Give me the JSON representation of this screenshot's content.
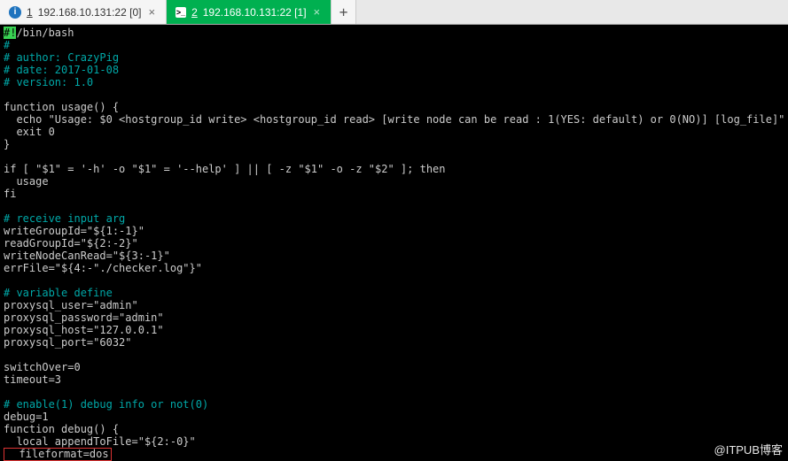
{
  "tabs": {
    "t0": {
      "num": "1",
      "label": "192.168.10.131:22 [0]"
    },
    "t1": {
      "num": "2",
      "label": "192.168.10.131:22 [1]"
    }
  },
  "newTabGlyph": "+",
  "closeGlyph": "×",
  "term": {
    "shebang": "#!",
    "sheb_rest": "/bin/bash",
    "c1": "#",
    "c2": "# author: CrazyPig",
    "c3": "# date: 2017-01-08",
    "c4": "# version: 1.0",
    "l_funcusage": "function usage() {",
    "l_echo": "  echo \"Usage: $0 <hostgroup_id write> <hostgroup_id read> [write node can be read : 1(YES: default) or 0(NO)] [log_file]\"",
    "l_exit0": "  exit 0",
    "l_brace": "}",
    "l_if": "if [ \"$1\" = '-h' -o \"$1\" = '--help' ] || [ -z \"$1\" -o -z \"$2\" ]; then",
    "l_usagecall": "  usage",
    "l_fi": "fi",
    "c_recv": "# receive input arg",
    "l_wg": "writeGroupId=\"${1:-1}\"",
    "l_rg": "readGroupId=\"${2:-2}\"",
    "l_wr": "writeNodeCanRead=\"${3:-1}\"",
    "l_ef": "errFile=\"${4:-\"./checker.log\"}\"",
    "c_var": "# variable define",
    "l_pu": "proxysql_user=\"admin\"",
    "l_pp": "proxysql_password=\"admin\"",
    "l_ph": "proxysql_host=\"127.0.0.1\"",
    "l_po": "proxysql_port=\"6032\"",
    "l_so": "switchOver=0",
    "l_to": "timeout=3",
    "c_dbg": "# enable(1) debug info or not(0)",
    "l_dbg1": "debug=1",
    "l_fdbg": "function debug() {",
    "l_local": "  local appendToFile=\"${2:-0}\"",
    "status": "  fileformat=dos"
  },
  "watermark": "@ITPUB博客"
}
